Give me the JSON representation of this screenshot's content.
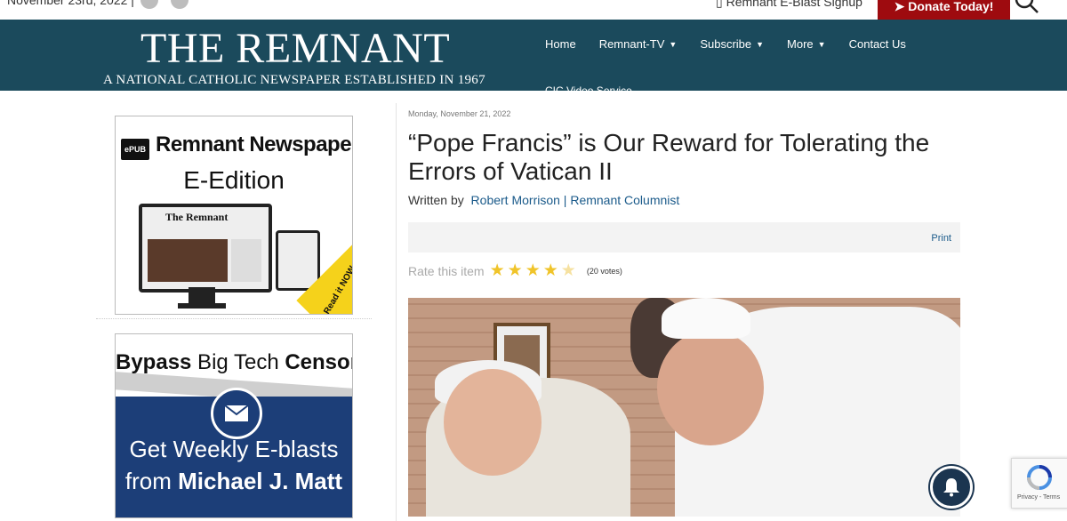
{
  "topbar": {
    "date": "November 23rd, 2022 |",
    "social_icons": [
      "facebook-icon",
      "twitter-icon"
    ],
    "eblast_label": "Remnant E-Blast Signup",
    "donate_label": "➤ Donate Today!",
    "donate_color": "#9e0b0f"
  },
  "header": {
    "title": "THE REMNANT",
    "subtitle": "A NATIONAL CATHOLIC NEWSPAPER ESTABLISHED IN 1967",
    "bg_color": "#1b4a5c",
    "nav": [
      {
        "label": "Home",
        "has_dropdown": false
      },
      {
        "label": "Remnant-TV",
        "has_dropdown": true
      },
      {
        "label": "Subscribe",
        "has_dropdown": true
      },
      {
        "label": "More",
        "has_dropdown": true
      },
      {
        "label": "Contact Us",
        "has_dropdown": false
      }
    ],
    "nav_overflow": "CIC Video Service"
  },
  "sidebar": {
    "ad1": {
      "epub_badge": "ePUB",
      "title": "Remnant Newspaper",
      "subtitle": "E-Edition",
      "monitor_title": "The Remnant",
      "badge": "Read it NOW"
    },
    "ad2": {
      "headline_a": "Bypass",
      "headline_b": " Big Tech ",
      "headline_c": "Censors",
      "line2": "Get Weekly E-blasts",
      "line3_prefix": "from ",
      "line3_name": "Michael J. Matt"
    }
  },
  "article": {
    "date": "Monday, November 21, 2022",
    "title": "“Pope Francis” is Our Reward for Tolerating the Errors of Vatican II",
    "written_by": "Written by",
    "author": "Robert Morrison | Remnant Columnist",
    "print_label": "Print",
    "rate_label": "Rate this item",
    "rating": 4.5,
    "rating_max": 5,
    "votes": "(20 votes)"
  },
  "widgets": {
    "recaptcha_text": "Privacy - Terms"
  }
}
